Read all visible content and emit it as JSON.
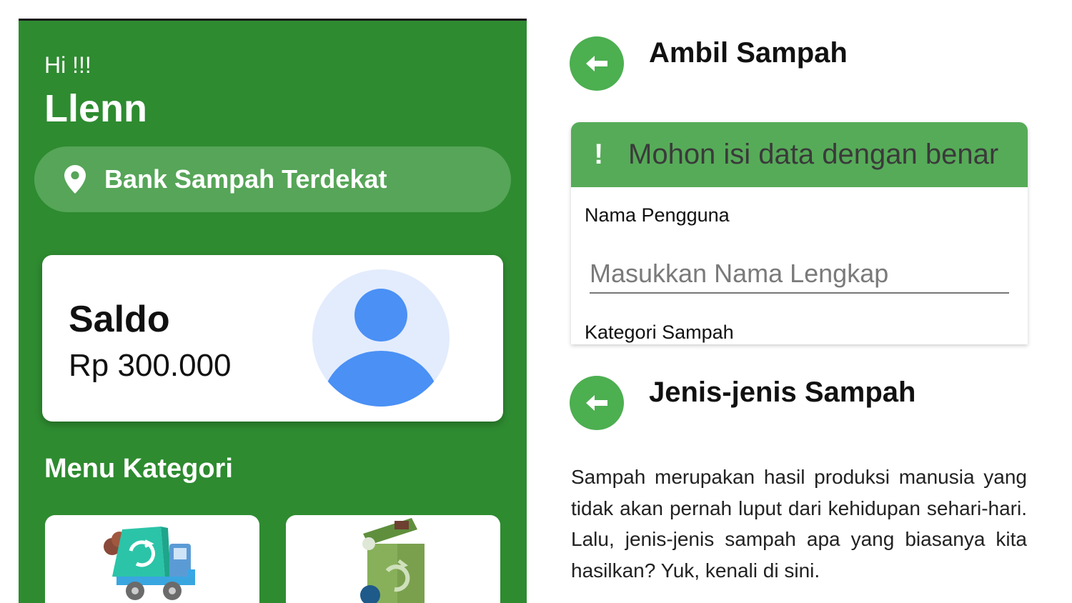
{
  "home": {
    "greeting": "Hi !!!",
    "username": "Llenn",
    "nearest_bank_label": "Bank Sampah Terdekat",
    "balance_title": "Saldo",
    "balance_value": "Rp 300.000",
    "menu_title": "Menu Kategori",
    "categories": [
      {
        "icon": "garbage-truck-icon"
      },
      {
        "icon": "recycle-bin-icon"
      }
    ]
  },
  "pickup": {
    "title": "Ambil Sampah",
    "alert_icon": "!",
    "alert_message": "Mohon isi data dengan benar",
    "name_label": "Nama Pengguna",
    "name_placeholder": "Masukkan Nama Lengkap",
    "name_value": "",
    "category_label": "Kategori Sampah"
  },
  "types": {
    "title": "Jenis-jenis Sampah",
    "description": "Sampah merupakan hasil produksi manusia yang tidak akan pernah luput dari kehidupan sehari-hari. Lalu, jenis-jenis sampah apa yang biasanya kita hasilkan? Yuk, kenali di sini."
  },
  "colors": {
    "primary_green": "#2e8b30",
    "light_green": "#56a558",
    "button_green": "#4caf50",
    "avatar_blue": "#4a90f5",
    "avatar_bg": "#e3ecfd"
  }
}
